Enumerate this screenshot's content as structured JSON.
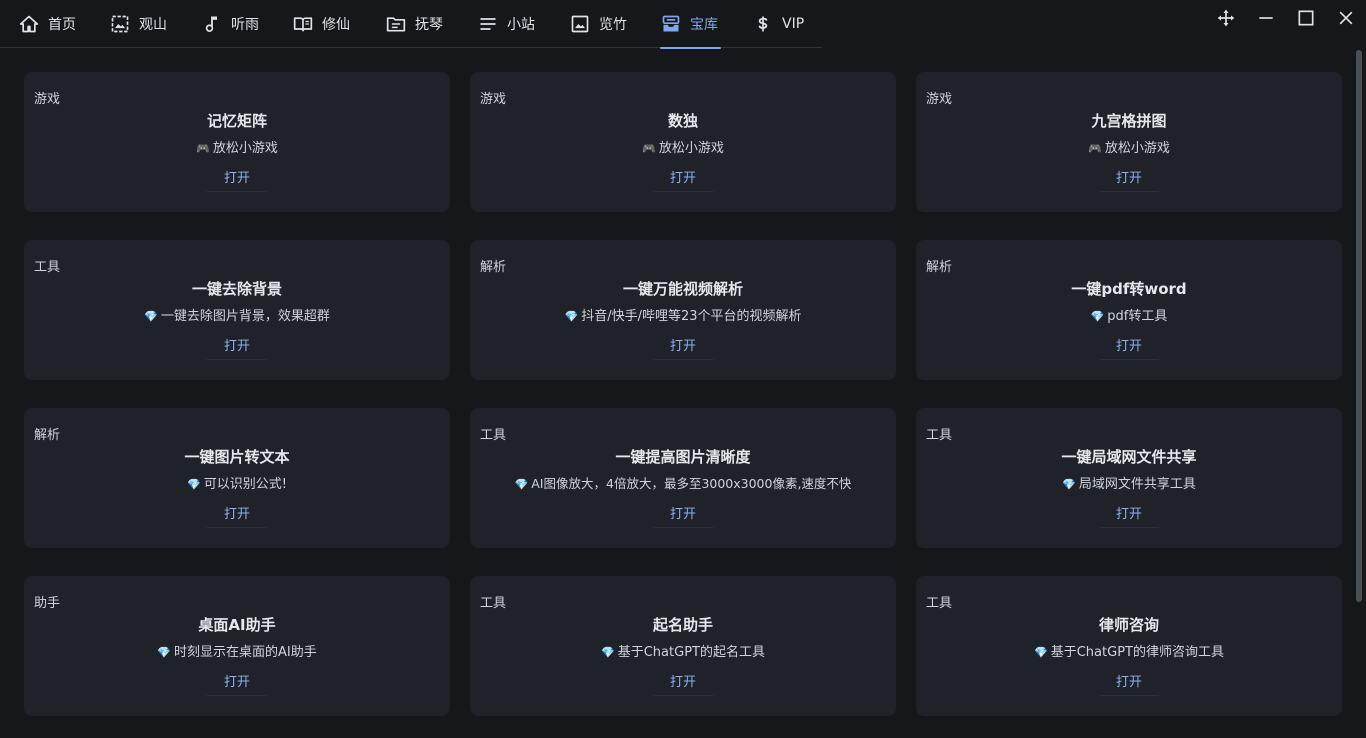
{
  "tabs": [
    {
      "label": "首页",
      "icon": "home-icon"
    },
    {
      "label": "观山",
      "icon": "image-frame-icon"
    },
    {
      "label": "听雨",
      "icon": "music-note-icon"
    },
    {
      "label": "修仙",
      "icon": "book-open-icon"
    },
    {
      "label": "抚琴",
      "icon": "folder-icon"
    },
    {
      "label": "小站",
      "icon": "menu-lines-icon"
    },
    {
      "label": "览竹",
      "icon": "picture-icon"
    },
    {
      "label": "宝库",
      "icon": "inbox-icon"
    },
    {
      "label": "VIP",
      "icon": "dollar-icon"
    }
  ],
  "active_tab": "宝库",
  "accent_color": "#7fa7ef",
  "window_controls": [
    "move-icon",
    "minimize-icon",
    "maximize-icon",
    "close-icon"
  ],
  "cards": [
    {
      "category": "游戏",
      "title": "记忆矩阵",
      "emoji": "🎮",
      "desc": "放松小游戏",
      "button": "打开"
    },
    {
      "category": "游戏",
      "title": "数独",
      "emoji": "🎮",
      "desc": "放松小游戏",
      "button": "打开"
    },
    {
      "category": "游戏",
      "title": "九宫格拼图",
      "emoji": "🎮",
      "desc": "放松小游戏",
      "button": "打开"
    },
    {
      "category": "工具",
      "title": "一键去除背景",
      "emoji": "💎",
      "desc": "一键去除图片背景，效果超群",
      "button": "打开"
    },
    {
      "category": "解析",
      "title": "一键万能视频解析",
      "emoji": "💎",
      "desc": "抖音/快手/哔哩等23个平台的视频解析",
      "button": "打开"
    },
    {
      "category": "解析",
      "title": "一键pdf转word",
      "emoji": "💎",
      "desc": "pdf转工具",
      "button": "打开"
    },
    {
      "category": "解析",
      "title": "一键图片转文本",
      "emoji": "💎",
      "desc": "可以识别公式!",
      "button": "打开"
    },
    {
      "category": "工具",
      "title": "一键提高图片清晰度",
      "emoji": "💎",
      "desc": "AI图像放大，4倍放大，最多至3000x3000像素,速度不快",
      "button": "打开"
    },
    {
      "category": "工具",
      "title": "一键局域网文件共享",
      "emoji": "💎",
      "desc": "局域网文件共享工具",
      "button": "打开"
    },
    {
      "category": "助手",
      "title": "桌面AI助手",
      "emoji": "💎",
      "desc": "时刻显示在桌面的AI助手",
      "button": "打开"
    },
    {
      "category": "工具",
      "title": "起名助手",
      "emoji": "💎",
      "desc": "基于ChatGPT的起名工具",
      "button": "打开"
    },
    {
      "category": "工具",
      "title": "律师咨询",
      "emoji": "💎",
      "desc": "基于ChatGPT的律师咨询工具",
      "button": "打开"
    }
  ]
}
